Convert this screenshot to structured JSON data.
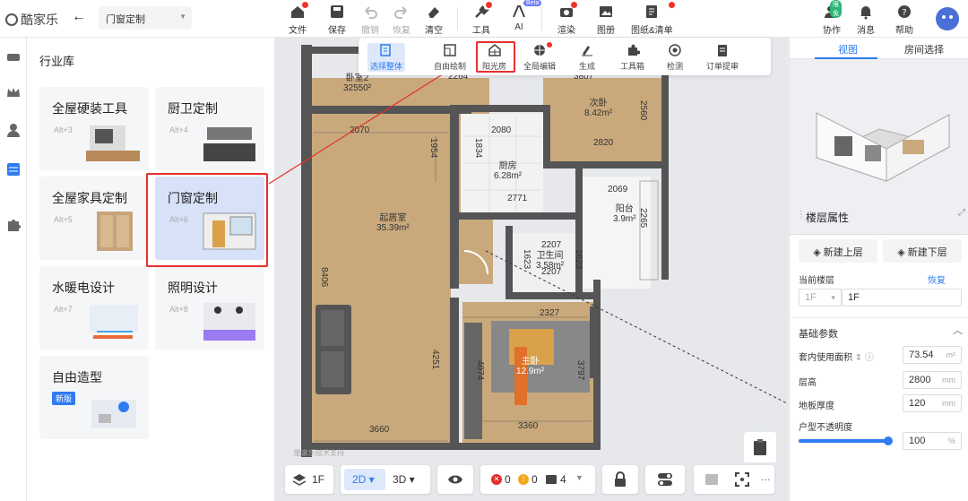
{
  "app": {
    "logo_text": "酷家乐",
    "title": "门窗定制"
  },
  "toolbar": {
    "file": "文件",
    "save": "保存",
    "undo": "撤销",
    "redo": "恢复",
    "clear": "清空",
    "tools": "工具",
    "ai": "AI",
    "ai_badge": "Beta",
    "render": "渲染",
    "album": "图册",
    "drawings": "图纸&清单",
    "collab": "协作",
    "collab_badge": "限免",
    "message": "消息",
    "help": "帮助"
  },
  "library": {
    "title": "行业库",
    "cards": [
      {
        "name": "全屋硬装工具",
        "hotkey": "Alt+3"
      },
      {
        "name": "厨卫定制",
        "hotkey": "Alt+4"
      },
      {
        "name": "全屋家具定制",
        "hotkey": "Alt+5"
      },
      {
        "name": "门窗定制",
        "hotkey": "Alt+6"
      },
      {
        "name": "水暖电设计",
        "hotkey": "Alt+7"
      },
      {
        "name": "照明设计",
        "hotkey": "Alt+8"
      },
      {
        "name": "自由造型",
        "badge": "新版"
      }
    ]
  },
  "floatbar": {
    "select": "选择整体",
    "free_draw": "自由绘制",
    "sunroom": "阳光房",
    "global_edit": "全局编辑",
    "generate": "生成",
    "toolbox": "工具箱",
    "check": "检测",
    "order": "订单提审"
  },
  "plan": {
    "rooms": [
      {
        "name": "卧室2",
        "area": "32550²"
      },
      {
        "name": "次卧",
        "area": "8.42m²"
      },
      {
        "name": "厨房",
        "area": "6.28m²"
      },
      {
        "name": "阳台",
        "area": "3.9m²"
      },
      {
        "name": "起居室",
        "area": "35.39m²"
      },
      {
        "name": "卫生间",
        "area": "3.58m²"
      },
      {
        "name": "主卧",
        "area": "12.9m²"
      }
    ],
    "dims": [
      "2264",
      "3807",
      "2070",
      "1954",
      "2080",
      "2560",
      "1834",
      "2820",
      "2771",
      "2069",
      "2265",
      "2207",
      "1623",
      "1623",
      "2207",
      "8406",
      "2327",
      "4251",
      "4074",
      "3797",
      "3660",
      "3360"
    ],
    "watermark": "酷家乐技术支持"
  },
  "bottombar": {
    "floor": "1F",
    "view2d": "2D",
    "view3d": "3D",
    "errors": "0",
    "warnings": "0",
    "count": "4"
  },
  "right_panel": {
    "tab_view": "视图",
    "tab_room": "房间选择",
    "floor_title": "楼层属性",
    "new_above": "新建上层",
    "new_below": "新建下层",
    "current_floor_label": "当前楼层",
    "restore": "恢复",
    "floor_select": "1F",
    "floor_name": "1F",
    "basic_params": "基础参数",
    "area_label": "套内使用面积",
    "area_value": "73.54",
    "area_unit": "m²",
    "height_label": "层高",
    "height_value": "2800",
    "height_unit": "mm",
    "thickness_label": "地板厚度",
    "thickness_value": "120",
    "thickness_unit": "mm",
    "opacity_label": "户型不透明度",
    "opacity_value": "100",
    "opacity_unit": "%",
    "opacity_level": 1.0
  },
  "colors": {
    "accent": "#2f7bf0",
    "highlight": "#e5302a"
  }
}
